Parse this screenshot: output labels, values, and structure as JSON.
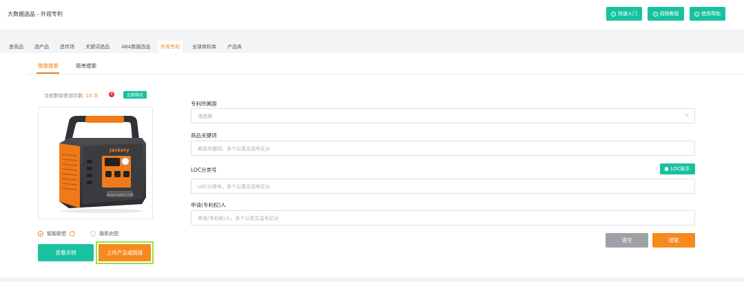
{
  "header": {
    "title": "大数据选品 - 外观专利",
    "buttons": [
      {
        "label": "快速入门",
        "icon": "compass-icon"
      },
      {
        "label": "视频教程",
        "icon": "play-icon"
      },
      {
        "label": "使用帮助",
        "icon": "question-icon"
      }
    ]
  },
  "tabs": [
    {
      "label": "查竞品",
      "active": false
    },
    {
      "label": "选产品",
      "active": false
    },
    {
      "label": "选市场",
      "active": false
    },
    {
      "label": "关键词选品",
      "active": false
    },
    {
      "label": "ABA数据选品",
      "active": false
    },
    {
      "label": "外观专利",
      "active": true
    },
    {
      "label": "全球商标库",
      "active": false
    },
    {
      "label": "产品库",
      "active": false
    }
  ],
  "subtabs": [
    {
      "label": "图像搜索",
      "active": true
    },
    {
      "label": "简单搜索",
      "active": false
    }
  ],
  "quota": {
    "prefix": "当前剩余查询次数:",
    "count": "10 次",
    "buy_label": "立即购买"
  },
  "product_image": {
    "brand": "Jackery",
    "model_text": "Jackery Explorer 1000"
  },
  "mode": {
    "options": [
      {
        "label": "智能联想",
        "selected": true
      },
      {
        "label": "搜索此图",
        "selected": false
      }
    ]
  },
  "actions": {
    "example_label": "查看示例",
    "upload_label": "上传产品或链接"
  },
  "form": {
    "country": {
      "label": "专利所属国",
      "placeholder": "请选择"
    },
    "keyword": {
      "label": "商品关键词",
      "placeholder": "商品关键词，多个以英文逗号区分"
    },
    "loc": {
      "label": "LOC分类号",
      "placeholder": "LOC分类号，多个以英文逗号区分",
      "helper_label": "LOC助手"
    },
    "applicant": {
      "label": "申请(专利权)人",
      "placeholder": "申请(专利权)人，多个以英文逗号区分"
    },
    "clear_label": "清空",
    "search_label": "搜索"
  },
  "colors": {
    "accent": "#f0811f",
    "primary": "#18c2a0",
    "highlight": "#9be03a"
  }
}
